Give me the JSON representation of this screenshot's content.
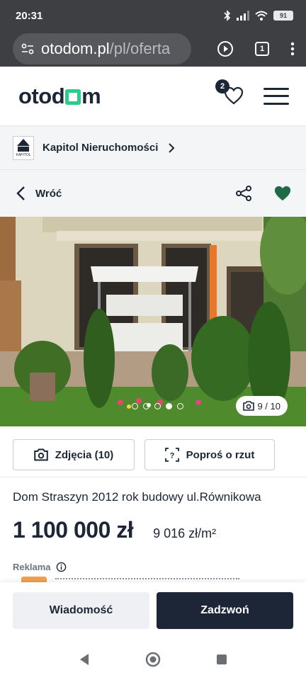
{
  "status_bar": {
    "time": "20:31",
    "battery": "91",
    "icons": [
      "bluetooth-icon",
      "signal-icon",
      "wifi-icon",
      "battery-icon"
    ]
  },
  "browser": {
    "url_domain": "otodom.pl",
    "url_path": "/pl/oferta",
    "tab_count": "1",
    "icons": [
      "site-settings-icon",
      "play-icon",
      "tabs-icon",
      "more-vertical-icon"
    ]
  },
  "header": {
    "logo_pre": "otod",
    "logo_post": "m",
    "favorites_count": "2",
    "icons": [
      "heart-outline-icon",
      "hamburger-menu-icon"
    ]
  },
  "agency": {
    "name": "Kapitol Nieruchomości",
    "logo_text": "KAPITOL"
  },
  "back_bar": {
    "label": "Wróć",
    "icons": [
      "chevron-left-icon",
      "share-icon",
      "heart-filled-icon"
    ]
  },
  "gallery": {
    "counter": "9 / 10",
    "current_index": 4,
    "dot_count": 5
  },
  "actions": {
    "photos_label": "Zdjęcia (10)",
    "plan_label": "Poproś o rzut"
  },
  "listing": {
    "title": "Dom Straszyn 2012 rok budowy ul.Równikowa",
    "price": "1 100 000 zł",
    "price_per_sqm": "9 016 zł/m²"
  },
  "ad": {
    "label": "Reklama"
  },
  "cta": {
    "message_label": "Wiadomość",
    "call_label": "Zadzwoń"
  },
  "colors": {
    "brand_dark": "#1d2636",
    "brand_green": "#2ccd8a",
    "favorite_green": "#1f6b45",
    "browser_chrome": "#3d3f42"
  }
}
